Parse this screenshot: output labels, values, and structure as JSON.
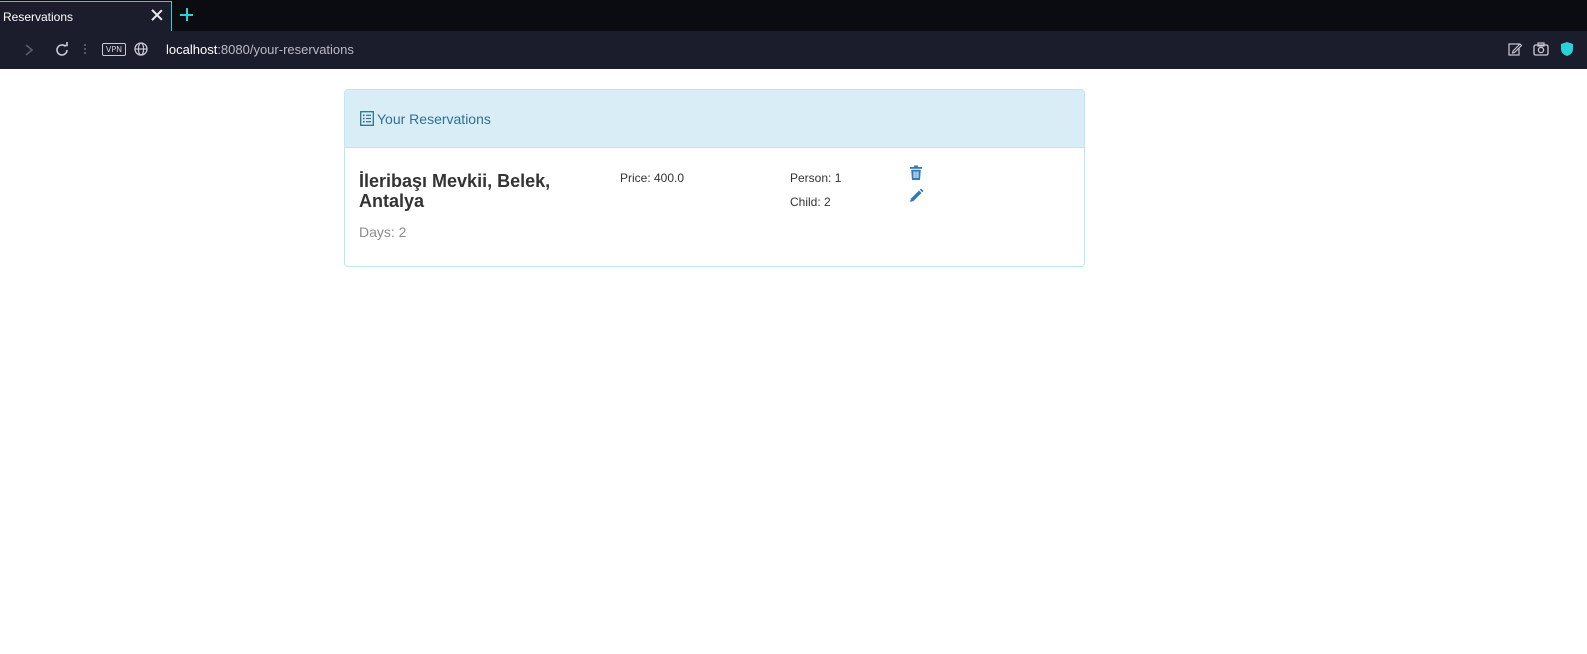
{
  "browser": {
    "tab_title": "Reservations",
    "url_host": "localhost",
    "url_rest": ":8080/your-reservations",
    "vpn_label": "VPN",
    "accent_color": "#2ad1d9"
  },
  "panel": {
    "title": "Your Reservations",
    "heading_icon": "list-alt-icon"
  },
  "reservations": [
    {
      "place": "İleribaşı Mevkii, Belek, Antalya",
      "days_label": "Days: 2",
      "price_label": "Price: 400.0",
      "person_label": "Person: 1",
      "child_label": "Child: 2",
      "delete_icon": "trash-icon",
      "edit_icon": "pencil-icon"
    }
  ],
  "colors": {
    "heading_bg": "#d9edf7",
    "heading_text": "#31708f",
    "icon_blue": "#337ab7"
  }
}
